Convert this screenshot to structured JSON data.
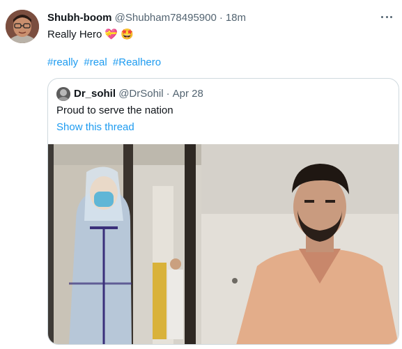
{
  "tweet": {
    "display_name": "Shubh-boom",
    "handle": "@Shubham78495900",
    "separator": "·",
    "time": "18m",
    "text": "Really Hero",
    "emoji_1": "💝",
    "emoji_2": "🤩",
    "hashtags": [
      "#really",
      "#real",
      "#Realhero"
    ],
    "avatar_icon": "user-avatar",
    "more_icon": "more-horizontal-icon"
  },
  "quoted": {
    "display_name": "Dr_sohil",
    "handle": "@DrSohil",
    "separator": "·",
    "time": "Apr 28",
    "text": "Proud to serve the nation",
    "show_thread": "Show this thread",
    "avatar_icon": "user-avatar",
    "media_icon": "photo-doctor-in-ppe-and-sweat-soaked-doctor"
  },
  "colors": {
    "link": "#1d9bf0",
    "text": "#0f1419",
    "secondary": "#536471",
    "border": "#cfd9de"
  }
}
